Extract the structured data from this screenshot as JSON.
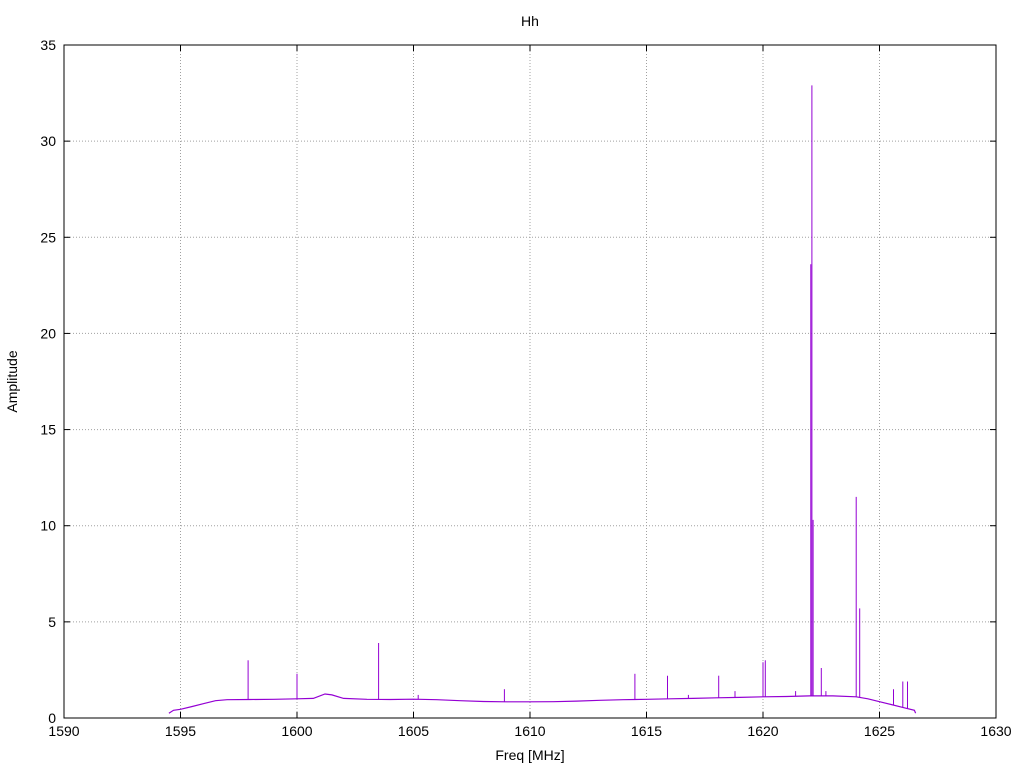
{
  "chart_data": {
    "type": "line",
    "title": "Hh",
    "xlabel": "Freq [MHz]",
    "ylabel": "Amplitude",
    "xlim": [
      1590,
      1630
    ],
    "ylim": [
      0,
      35
    ],
    "x_ticks": [
      1590,
      1595,
      1600,
      1605,
      1610,
      1615,
      1620,
      1625,
      1630
    ],
    "y_ticks": [
      0,
      5,
      10,
      15,
      20,
      25,
      30,
      35
    ],
    "grid": true,
    "legend": "none",
    "colors": {
      "series": "#9400d3",
      "grid": "#a0a0a0",
      "axis": "#000000"
    },
    "series": [
      {
        "baseline": [
          [
            1594.5,
            0.25
          ],
          [
            1594.7,
            0.4
          ],
          [
            1595.0,
            0.45
          ],
          [
            1595.5,
            0.6
          ],
          [
            1596.0,
            0.75
          ],
          [
            1596.5,
            0.9
          ],
          [
            1597.0,
            0.95
          ],
          [
            1598.0,
            0.96
          ],
          [
            1599.0,
            0.97
          ],
          [
            1600.0,
            1.0
          ],
          [
            1600.7,
            1.02
          ],
          [
            1601.2,
            1.25
          ],
          [
            1601.5,
            1.2
          ],
          [
            1602.0,
            1.02
          ],
          [
            1603.0,
            0.97
          ],
          [
            1604.0,
            0.96
          ],
          [
            1605.0,
            0.98
          ],
          [
            1606.0,
            0.95
          ],
          [
            1607.0,
            0.9
          ],
          [
            1608.0,
            0.86
          ],
          [
            1609.0,
            0.84
          ],
          [
            1610.0,
            0.84
          ],
          [
            1611.0,
            0.85
          ],
          [
            1612.0,
            0.88
          ],
          [
            1613.0,
            0.92
          ],
          [
            1614.0,
            0.95
          ],
          [
            1615.0,
            0.97
          ],
          [
            1616.0,
            1.0
          ],
          [
            1617.0,
            1.02
          ],
          [
            1618.0,
            1.05
          ],
          [
            1619.0,
            1.07
          ],
          [
            1620.0,
            1.1
          ],
          [
            1621.0,
            1.12
          ],
          [
            1622.0,
            1.15
          ],
          [
            1623.0,
            1.15
          ],
          [
            1624.0,
            1.1
          ],
          [
            1624.5,
            1.0
          ],
          [
            1625.0,
            0.85
          ],
          [
            1625.5,
            0.7
          ],
          [
            1626.0,
            0.55
          ],
          [
            1626.5,
            0.4
          ],
          [
            1626.55,
            0.25
          ]
        ],
        "spikes": [
          [
            1597.9,
            3.0
          ],
          [
            1600.0,
            2.3
          ],
          [
            1603.5,
            3.9
          ],
          [
            1605.2,
            1.2
          ],
          [
            1608.9,
            1.5
          ],
          [
            1614.5,
            2.3
          ],
          [
            1615.9,
            2.2
          ],
          [
            1616.8,
            1.2
          ],
          [
            1618.1,
            2.2
          ],
          [
            1618.8,
            1.4
          ],
          [
            1620.0,
            2.9
          ],
          [
            1620.1,
            3.0
          ],
          [
            1621.4,
            1.4
          ],
          [
            1622.05,
            23.6
          ],
          [
            1622.1,
            32.9
          ],
          [
            1622.15,
            10.3
          ],
          [
            1622.5,
            2.6
          ],
          [
            1622.7,
            1.4
          ],
          [
            1624.0,
            11.5
          ],
          [
            1624.15,
            5.7
          ],
          [
            1625.6,
            1.5
          ],
          [
            1626.0,
            1.9
          ],
          [
            1626.2,
            1.9
          ]
        ]
      }
    ]
  }
}
